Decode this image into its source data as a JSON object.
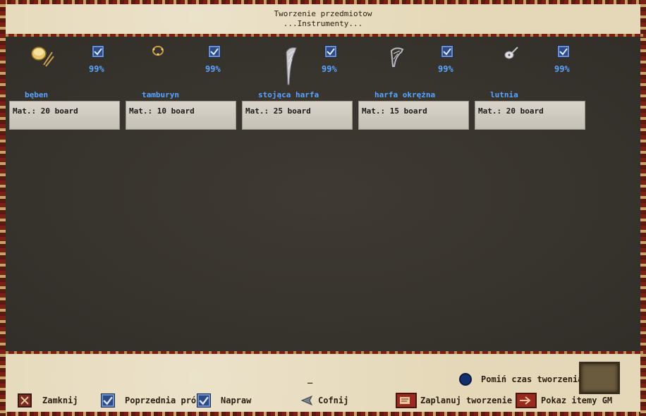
{
  "header": {
    "title": "Tworzenie przedmiotow",
    "subtitle": "...Instrumenty..."
  },
  "items": [
    {
      "name": "bęben",
      "percent": "99%",
      "material": "Mat.: 20 board",
      "icon": "drum-icon",
      "checked": true
    },
    {
      "name": "tamburyn",
      "percent": "99%",
      "material": "Mat.: 10 board",
      "icon": "tambourine-icon",
      "checked": true
    },
    {
      "name": "stojąca harfa",
      "percent": "99%",
      "material": "Mat.: 25 board",
      "icon": "standing-harp-icon",
      "checked": true
    },
    {
      "name": "harfa okrężna",
      "percent": "99%",
      "material": "Mat.: 15 board",
      "icon": "lap-harp-icon",
      "checked": true
    },
    {
      "name": "lutnia",
      "percent": "99%",
      "material": "Mat.: 20 board",
      "icon": "lute-icon",
      "checked": true
    }
  ],
  "footer": {
    "skip_time_label": "Pomiń czas tworzenia",
    "close_label": "Zamknij",
    "previous_label": "Poprzednia próba",
    "repair_label": "Napraw",
    "back_label": "Cofnij",
    "schedule_label": "Zaplanuj tworzenie",
    "show_gm_label": "Pokaz itemy GM",
    "dash": "_"
  },
  "colors": {
    "accent_blue": "#5aa4ff",
    "parchment": "#e5d8b8",
    "main_bg": "#3a3630"
  }
}
